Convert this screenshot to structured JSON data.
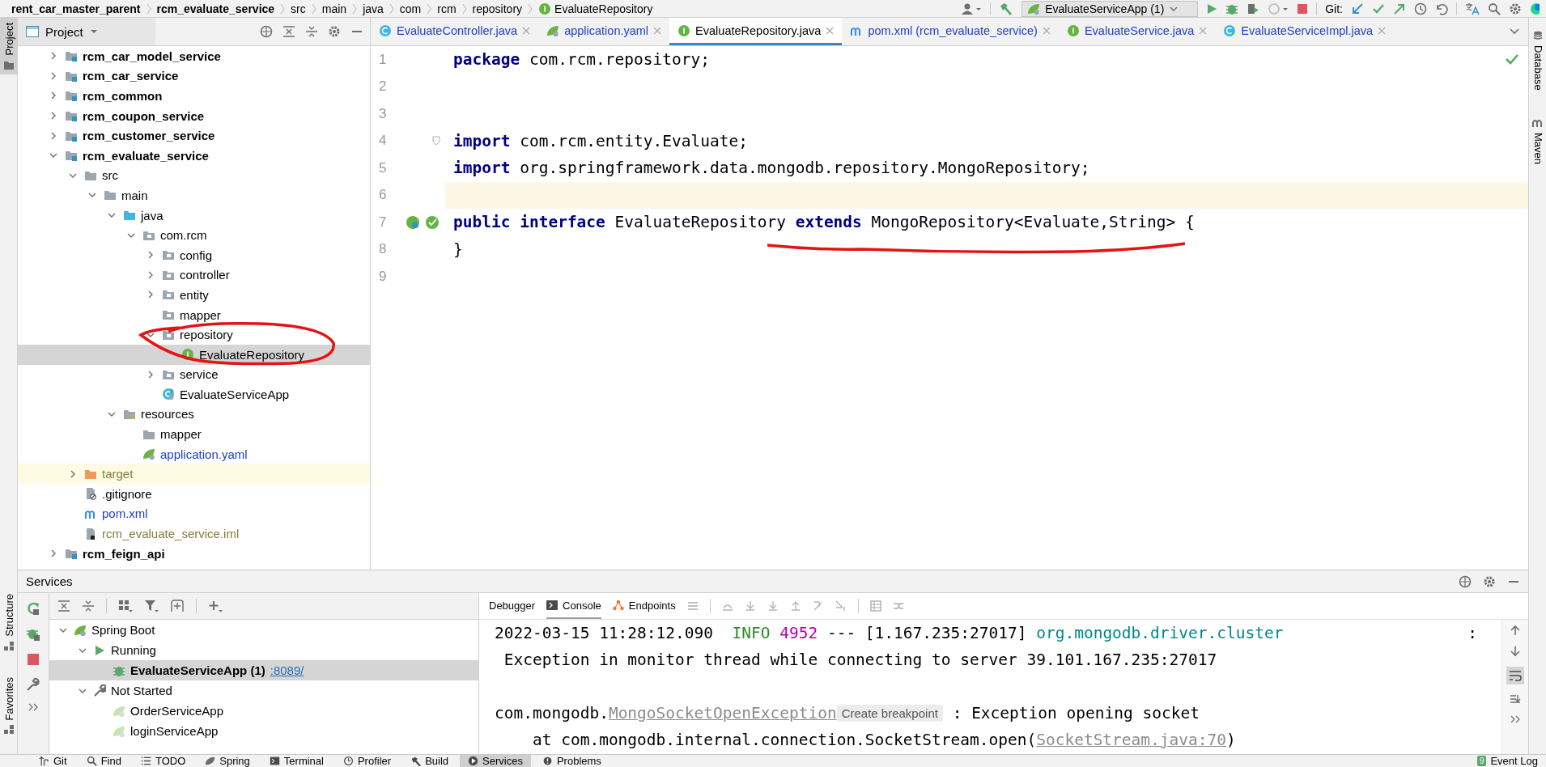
{
  "breadcrumbs": [
    {
      "label": "rent_car_master_parent",
      "kind": "module"
    },
    {
      "label": "rcm_evaluate_service",
      "kind": "module"
    },
    {
      "label": "src",
      "kind": "folder"
    },
    {
      "label": "main",
      "kind": "folder"
    },
    {
      "label": "java",
      "kind": "folder"
    },
    {
      "label": "com",
      "kind": "folder"
    },
    {
      "label": "rcm",
      "kind": "folder"
    },
    {
      "label": "repository",
      "kind": "folder"
    },
    {
      "label": "EvaluateRepository",
      "kind": "interface"
    }
  ],
  "toolbar": {
    "run_config": "EvaluateServiceApp (1)",
    "git_label": "Git:"
  },
  "left_stripe": {
    "top": [
      {
        "label": "Project",
        "selected": true
      }
    ],
    "bottom": [
      {
        "label": "Structure",
        "selected": false
      },
      {
        "label": "Favorites",
        "selected": false
      }
    ]
  },
  "right_stripe": [
    {
      "label": "Database",
      "kind": "database"
    },
    {
      "label": "Maven",
      "kind": "maven"
    }
  ],
  "project_panel": {
    "title": "Project",
    "tree": [
      {
        "label": "rcm_car_model_service",
        "kind": "module",
        "expanded": false,
        "selected": false,
        "color": "#000000"
      },
      {
        "label": "rcm_car_service",
        "kind": "module",
        "expanded": false,
        "selected": false,
        "color": "#000000"
      },
      {
        "label": "rcm_common",
        "kind": "module",
        "expanded": false,
        "selected": false,
        "color": "#000000"
      },
      {
        "label": "rcm_coupon_service",
        "kind": "module",
        "expanded": false,
        "selected": false,
        "color": "#000000"
      },
      {
        "label": "rcm_customer_service",
        "kind": "module",
        "expanded": false,
        "selected": false,
        "color": "#000000"
      },
      {
        "label": "rcm_evaluate_service",
        "kind": "module",
        "expanded": true,
        "selected": false,
        "color": "#000000",
        "children": [
          {
            "label": "src",
            "kind": "folder",
            "expanded": true,
            "selected": false,
            "color": "#000000",
            "children": [
              {
                "label": "main",
                "kind": "folder",
                "expanded": true,
                "selected": false,
                "color": "#000000",
                "children": [
                  {
                    "label": "java",
                    "kind": "source-root",
                    "expanded": true,
                    "selected": false,
                    "color": "#000000",
                    "children": [
                      {
                        "label": "com.rcm",
                        "kind": "package",
                        "expanded": true,
                        "selected": false,
                        "color": "#000000",
                        "children": [
                          {
                            "label": "config",
                            "kind": "package",
                            "expanded": false,
                            "selected": false,
                            "color": "#000000"
                          },
                          {
                            "label": "controller",
                            "kind": "package",
                            "expanded": false,
                            "selected": false,
                            "color": "#000000"
                          },
                          {
                            "label": "entity",
                            "kind": "package",
                            "expanded": false,
                            "selected": false,
                            "color": "#000000"
                          },
                          {
                            "label": "mapper",
                            "kind": "package",
                            "selected": false,
                            "color": "#000000"
                          },
                          {
                            "label": "repository",
                            "kind": "package",
                            "expanded": true,
                            "selected": false,
                            "color": "#000000",
                            "children": [
                              {
                                "label": "EvaluateRepository",
                                "kind": "interface",
                                "selected": true,
                                "color": "#000000"
                              }
                            ]
                          },
                          {
                            "label": "service",
                            "kind": "package",
                            "expanded": false,
                            "selected": false,
                            "color": "#000000"
                          },
                          {
                            "label": "EvaluateServiceApp",
                            "kind": "spring-class",
                            "selected": false,
                            "color": "#000000"
                          }
                        ]
                      }
                    ]
                  },
                  {
                    "label": "resources",
                    "kind": "resources-root",
                    "expanded": true,
                    "selected": false,
                    "color": "#000000",
                    "children": [
                      {
                        "label": "mapper",
                        "kind": "folder",
                        "selected": false,
                        "color": "#000000"
                      },
                      {
                        "label": "application.yaml",
                        "kind": "yaml",
                        "selected": false,
                        "color": "#2040c8"
                      }
                    ]
                  }
                ]
              }
            ]
          },
          {
            "label": "target",
            "kind": "excluded",
            "expanded": false,
            "selected": false,
            "color": "#827c3c"
          },
          {
            "label": ".gitignore",
            "kind": "gitignore",
            "selected": false,
            "color": "#000000"
          },
          {
            "label": "pom.xml",
            "kind": "maven",
            "selected": false,
            "color": "#2040c8"
          },
          {
            "label": "rcm_evaluate_service.iml",
            "kind": "iml",
            "selected": false,
            "color": "#827c3c"
          }
        ]
      },
      {
        "label": "rcm_feign_api",
        "kind": "module",
        "expanded": false,
        "selected": false,
        "color": "#000000"
      }
    ]
  },
  "editor": {
    "tabs": [
      {
        "label": "EvaluateController.java",
        "kind": "class",
        "selected": false,
        "modified": true
      },
      {
        "label": "application.yaml",
        "kind": "yaml",
        "selected": false,
        "modified": true
      },
      {
        "label": "EvaluateRepository.java",
        "kind": "interface",
        "selected": true,
        "modified": false
      },
      {
        "label": "pom.xml (rcm_evaluate_service)",
        "kind": "maven",
        "selected": false,
        "modified": true
      },
      {
        "label": "EvaluateService.java",
        "kind": "interface",
        "selected": false,
        "modified": true
      },
      {
        "label": "EvaluateServiceImpl.java",
        "kind": "class",
        "selected": false,
        "modified": true
      }
    ],
    "lines": [
      {
        "number": "1",
        "code": "**package** com.rcm.repository;",
        "current": false
      },
      {
        "number": "2",
        "current": false
      },
      {
        "number": "3",
        "current": false
      },
      {
        "number": "4",
        "code": "**import** com.rcm.entity.Evaluate;",
        "current": false,
        "markers": [
          {
            "kind": "fold"
          }
        ]
      },
      {
        "number": "5",
        "code": "**import** org.springframework.data.mongodb.repository.MongoRepository;",
        "current": false
      },
      {
        "number": "6",
        "current": true
      },
      {
        "number": "7",
        "code": "**public interface** EvaluateRepository **extends** MongoRepository<Evaluate,String> {",
        "current": false,
        "markers": [
          {
            "kind": "implemented"
          },
          {
            "kind": "spring-bean"
          }
        ]
      },
      {
        "number": "8",
        "code": "}",
        "current": false
      },
      {
        "number": "9",
        "current": false
      }
    ]
  },
  "services": {
    "title": "Services",
    "tree": [
      {
        "label": "Spring Boot",
        "kind": "group",
        "expanded": true,
        "selected": false,
        "children": [
          {
            "label": "Running",
            "kind": "running",
            "expanded": true,
            "selected": false,
            "children": [
              {
                "label": "EvaluateServiceApp (1)",
                "kind": "app-running",
                "selected": true,
                "link": ":8089/"
              }
            ]
          },
          {
            "label": "Not Started",
            "kind": "not-started",
            "expanded": true,
            "selected": false,
            "children": [
              {
                "label": "OrderServiceApp",
                "kind": "app",
                "selected": false
              },
              {
                "label": "loginServiceApp",
                "kind": "app",
                "selected": false
              }
            ]
          }
        ]
      }
    ],
    "tabs": [
      {
        "label": "Debugger",
        "kind": "debugger",
        "selected": false
      },
      {
        "label": "Console",
        "kind": "console",
        "selected": true
      },
      {
        "label": "Endpoints",
        "kind": "endpoints",
        "selected": false
      }
    ],
    "console": [
      {
        "kind": "text",
        "segments": [
          {
            "text": "2022-03-15 11:28:12.090  ",
            "kind": "plain"
          },
          {
            "text": "INFO",
            "kind": "level"
          },
          {
            "text": " 4952",
            "kind": "pid"
          },
          {
            "text": " --- [1.167.235:27017] ",
            "kind": "plain"
          },
          {
            "text": "org.mongodb.driver.cluster",
            "kind": "logger"
          },
          {
            "text": ":",
            "kind": "end"
          }
        ]
      },
      {
        "kind": "text",
        "segments": [
          {
            "text": " Exception in monitor thread while connecting to server 39.101.167.235:27017",
            "kind": "plain"
          }
        ]
      },
      {
        "kind": "blank"
      },
      {
        "kind": "text",
        "segments": [
          {
            "text": "com.mongodb.",
            "kind": "plain"
          },
          {
            "text": "MongoSocketOpenException",
            "kind": "link"
          },
          {
            "text": "Create breakpoint",
            "kind": "hint"
          },
          {
            "text": " : Exception opening socket",
            "kind": "plain"
          }
        ]
      },
      {
        "kind": "text",
        "segments": [
          {
            "text": "    at com.mongodb.internal.connection.SocketStream.open(",
            "kind": "plain"
          },
          {
            "text": "SocketStream.java:70",
            "kind": "link"
          },
          {
            "text": ")",
            "kind": "plain"
          }
        ]
      }
    ]
  },
  "bottom_bar": {
    "tools": [
      {
        "label": "Git",
        "kind": "git",
        "selected": false
      },
      {
        "label": "Find",
        "kind": "find",
        "selected": false
      },
      {
        "label": "TODO",
        "kind": "todo",
        "selected": false
      },
      {
        "label": "Spring",
        "kind": "spring",
        "selected": false
      },
      {
        "label": "Terminal",
        "kind": "terminal",
        "selected": false
      },
      {
        "label": "Profiler",
        "kind": "profiler",
        "selected": false
      },
      {
        "label": "Build",
        "kind": "build",
        "selected": false
      },
      {
        "label": "Services",
        "kind": "services",
        "selected": true
      },
      {
        "label": "Problems",
        "kind": "problems",
        "selected": false
      }
    ],
    "event_log": {
      "label": "Event Log",
      "count": "9"
    }
  }
}
